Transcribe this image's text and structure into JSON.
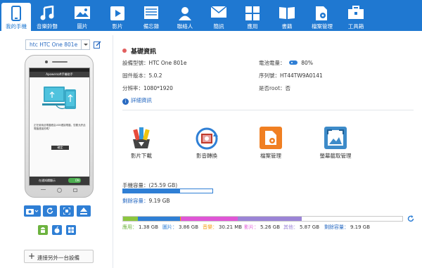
{
  "nav": [
    {
      "label": "我的手機",
      "icon": "phone-icon",
      "active": true
    },
    {
      "label": "音樂鈴聲",
      "icon": "music-note-icon"
    },
    {
      "label": "圖片",
      "icon": "picture-icon"
    },
    {
      "label": "影片",
      "icon": "video-play-icon"
    },
    {
      "label": "備忘錄",
      "icon": "memo-icon"
    },
    {
      "label": "聯絡人",
      "icon": "contact-icon"
    },
    {
      "label": "簡訊",
      "icon": "envelope-icon"
    },
    {
      "label": "應用",
      "icon": "apps-grid-icon"
    },
    {
      "label": "書籍",
      "icon": "book-icon"
    },
    {
      "label": "檔案管理",
      "icon": "file-gear-icon"
    },
    {
      "label": "工具箱",
      "icon": "toolbox-icon"
    }
  ],
  "device": {
    "selected": "htc HTC One 801e",
    "screen_title": "Apowersoft手機助手",
    "screen_text": "正在使用此電腦經由USB連接電腦，您要允許此電腦連接的嗎？",
    "screen_ok": "確定",
    "screen_bottom": "在通知欄顯示",
    "screen_toggle": "ON",
    "connect_label": "連接另外一台設備"
  },
  "info": {
    "title": "基礎資訊",
    "model_label": "設備型號：",
    "model_value": "HTC One 801e",
    "battery_label": "電池電量：",
    "battery_value": "80%",
    "firmware_label": "固件版本：",
    "firmware_value": "5.0.2",
    "serial_label": "序列號：",
    "serial_value": "HT44TW9A0141",
    "resolution_label": "分辨率：",
    "resolution_value": "1080*1920",
    "root_label": "是否root：",
    "root_value": "否",
    "details_link": "詳細資訊"
  },
  "tools": [
    {
      "label": "影片下載",
      "icon": "video-download-icon"
    },
    {
      "label": "影音轉換",
      "icon": "media-convert-icon"
    },
    {
      "label": "檔案管理",
      "icon": "file-manager-icon"
    },
    {
      "label": "螢幕截取管理",
      "icon": "screenshot-manager-icon"
    }
  ],
  "capacity": {
    "label": "手機容量：(25.59 GB)",
    "remaining_label": "剩餘容量：",
    "remaining_value": "9.19 GB",
    "used_fraction": 0.64
  },
  "storage": {
    "total_gb": 25.59,
    "segments": [
      {
        "label": "應用：",
        "value": "1.38 GB",
        "gb": 1.38,
        "color": "#8cc63f"
      },
      {
        "label": "圖片：",
        "value": "3.86 GB",
        "gb": 3.86,
        "color": "#2f7fd5"
      },
      {
        "label": "音樂：",
        "value": "30.21 MB",
        "gb": 0.03,
        "color": "#f39c12"
      },
      {
        "label": "影片：",
        "value": "5.26 GB",
        "gb": 5.26,
        "color": "#e056d6"
      },
      {
        "label": "其他：",
        "value": "5.87 GB",
        "gb": 5.87,
        "color": "#9b84d6"
      },
      {
        "label": "剩餘容量：",
        "value": "9.19 GB",
        "gb": 9.19,
        "color": "#ffffff"
      }
    ]
  },
  "colors": {
    "topbar": "#1f78d1",
    "accent": "#2f7fd5",
    "link": "#2a6bc2"
  }
}
